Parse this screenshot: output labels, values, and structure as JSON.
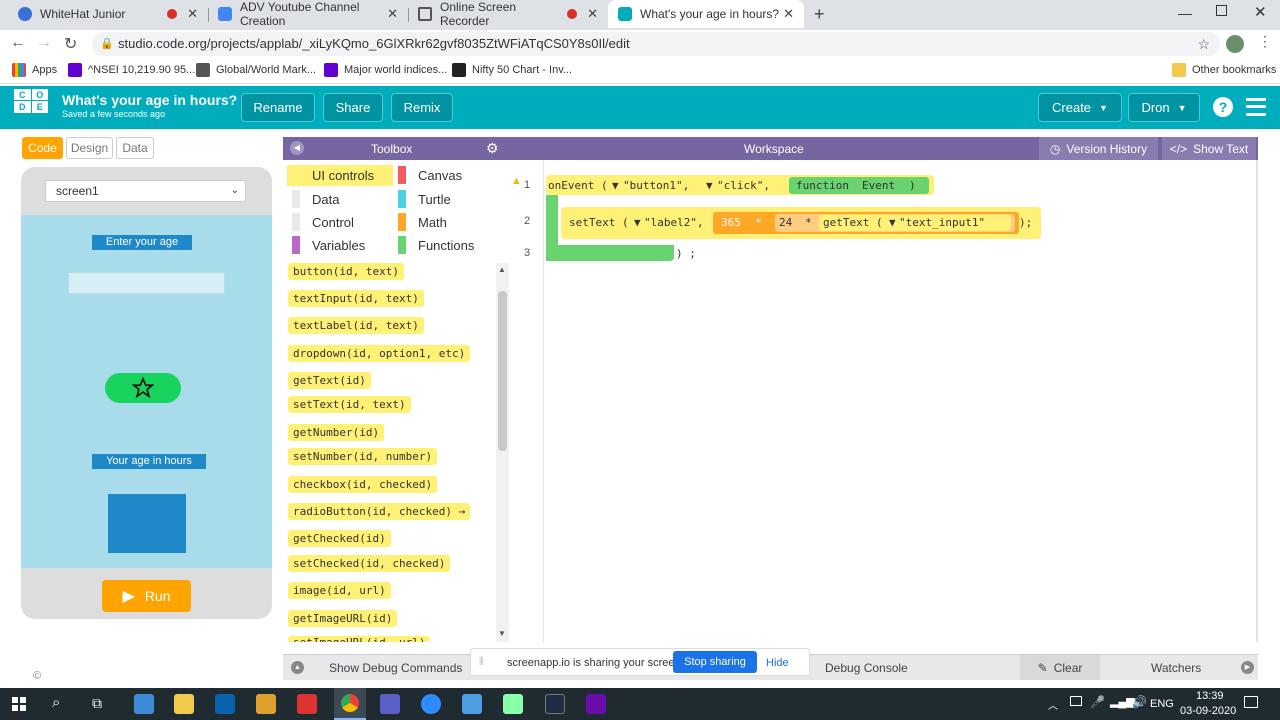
{
  "browser": {
    "tabs": [
      {
        "title": "WhiteHat Junior",
        "recording": true
      },
      {
        "title": "ADV Youtube Channel Creation",
        "recording": false
      },
      {
        "title": "Online Screen Recorder",
        "recording": true
      },
      {
        "title": "What's your age in hours? - App",
        "recording": false
      }
    ],
    "url": "studio.code.org/projects/applab/_xiLyKQmo_6GlXRkr62gvf8035ZtWFiATqCS0Y8s0Il/edit",
    "bookmarks": [
      "Apps",
      "^NSEI 10,219.90 95...",
      "Global/World Mark...",
      "Major world indices...",
      "Nifty 50 Chart - Inv..."
    ],
    "other_bookmarks": "Other bookmarks"
  },
  "header": {
    "logo_letters": [
      "C",
      "O",
      "D",
      "E"
    ],
    "project_title": "What's your age in hours?",
    "saved_status": "Saved a few seconds ago",
    "rename_label": "Rename",
    "share_label": "Share",
    "remix_label": "Remix",
    "create_label": "Create",
    "user_label": "Dron",
    "help_icon": "?"
  },
  "modes": {
    "code": "Code",
    "design": "Design",
    "data": "Data"
  },
  "app": {
    "screen_select": "screen1",
    "label_enter_age": "Enter your age",
    "label_age_hours": "Your age in hours",
    "run_label": "Run"
  },
  "toolbox": {
    "title": "Toolbox",
    "categories": [
      {
        "name": "UI controls",
        "color": "#fff176"
      },
      {
        "name": "Canvas",
        "color": "#f25c5c"
      },
      {
        "name": "Data",
        "color": "#fff"
      },
      {
        "name": "Turtle",
        "color": "#4dd0e1"
      },
      {
        "name": "Control",
        "color": "#fff"
      },
      {
        "name": "Math",
        "color": "#ffa726"
      },
      {
        "name": "Variables",
        "color": "#ba68c8"
      },
      {
        "name": "Functions",
        "color": "#68d36f"
      }
    ],
    "blocks": [
      "button(id, text)",
      "textInput(id, text)",
      "textLabel(id, text)",
      "dropdown(id, option1, etc)",
      "getText(id)",
      "setText(id, text)",
      "getNumber(id)",
      "setNumber(id, number)",
      "checkbox(id, checked)",
      "radioButton(id, checked) →",
      "getChecked(id)",
      "setChecked(id, checked)",
      "image(id, url)",
      "getImageURL(id)",
      "setImageURL(id, url)"
    ]
  },
  "workspace": {
    "title": "Workspace",
    "version_history": "Version History",
    "show_text": "Show Text",
    "lines": [
      "1",
      "2",
      "3"
    ],
    "code": {
      "onEvent": "onEvent (",
      "arg_button": "\"button1\",",
      "arg_click": "\"click\",",
      "function_kw": "function",
      "event_param": "Event",
      "setText": "setText (",
      "arg_label": "\"label2\",",
      "num_365": "365",
      "times1": "*",
      "num_24": "24",
      "times2": "*",
      "getText": "getText (",
      "arg_input": "\"text_input1\"",
      "close_paren": ") ) ) ;",
      "close_fn": ") ;"
    }
  },
  "debug": {
    "show_debug": "Show Debug Commands",
    "console": "Debug Console",
    "clear": "Clear",
    "watchers": "Watchers"
  },
  "share_banner": {
    "text": "screenapp.io is sharing your screen.",
    "stop": "Stop sharing",
    "hide": "Hide"
  },
  "taskbar": {
    "lang": "ENG",
    "time": "13:39",
    "date": "03-09-2020"
  }
}
